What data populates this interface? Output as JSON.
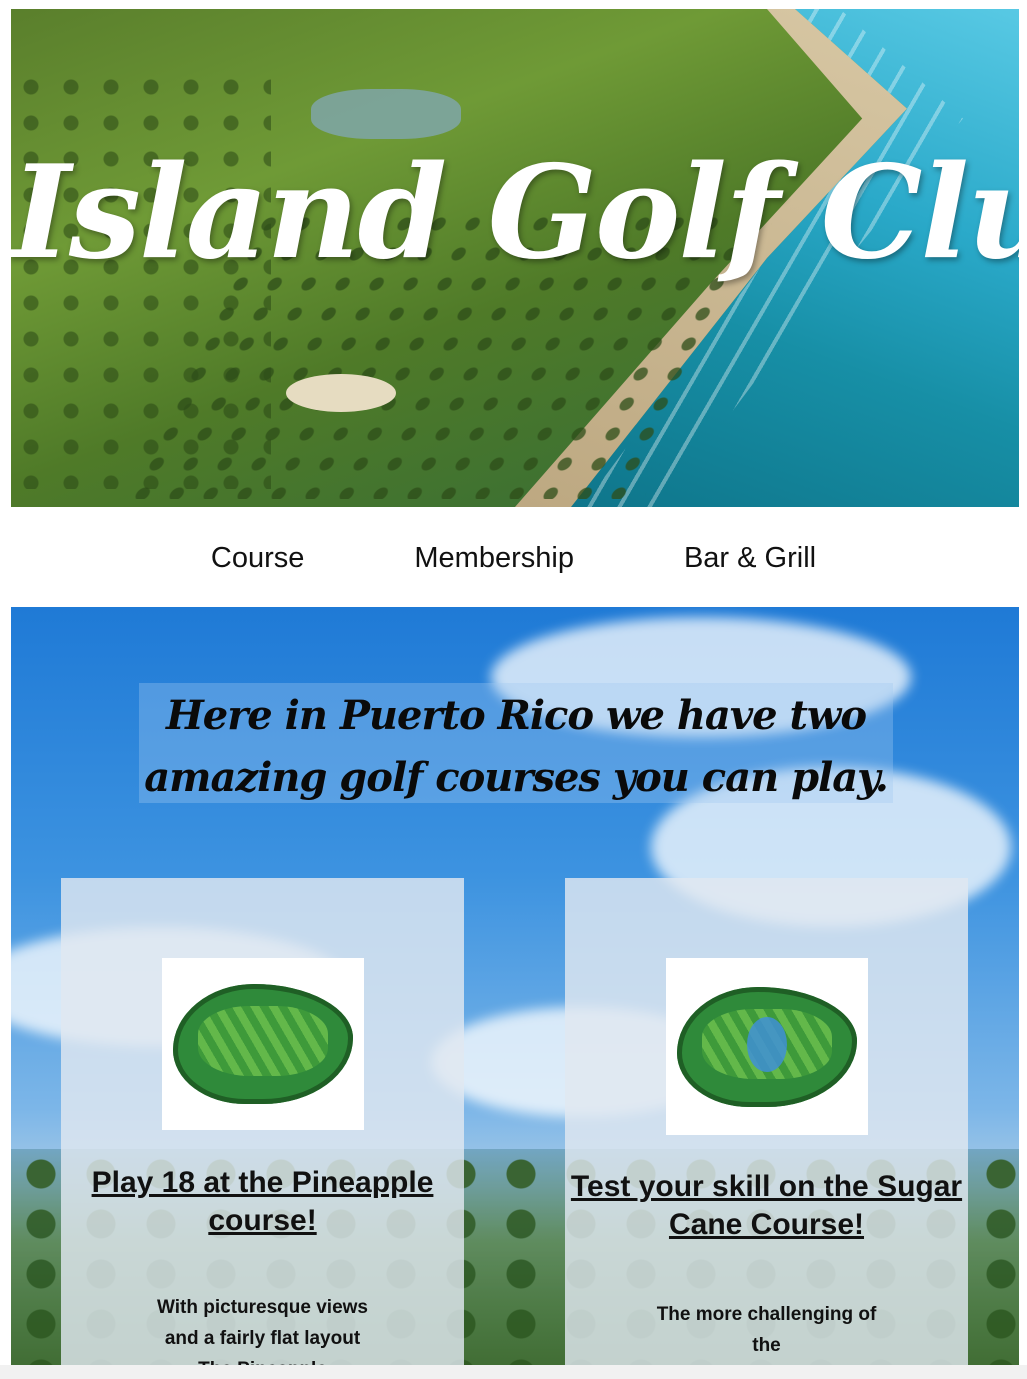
{
  "hero": {
    "title": "Island Golf Club"
  },
  "nav": {
    "items": [
      "Course",
      "Membership",
      "Bar & Grill"
    ]
  },
  "main": {
    "headline": "Here in Puerto Rico we have two amazing golf courses you can play.",
    "cards": [
      {
        "title": "Play 18 at the Pineapple course!",
        "body": "With picturesque views and a fairly flat layout The Pineapple"
      },
      {
        "title": "Test your skill on the Sugar Cane Course!",
        "body": "The more challenging of the"
      }
    ]
  }
}
